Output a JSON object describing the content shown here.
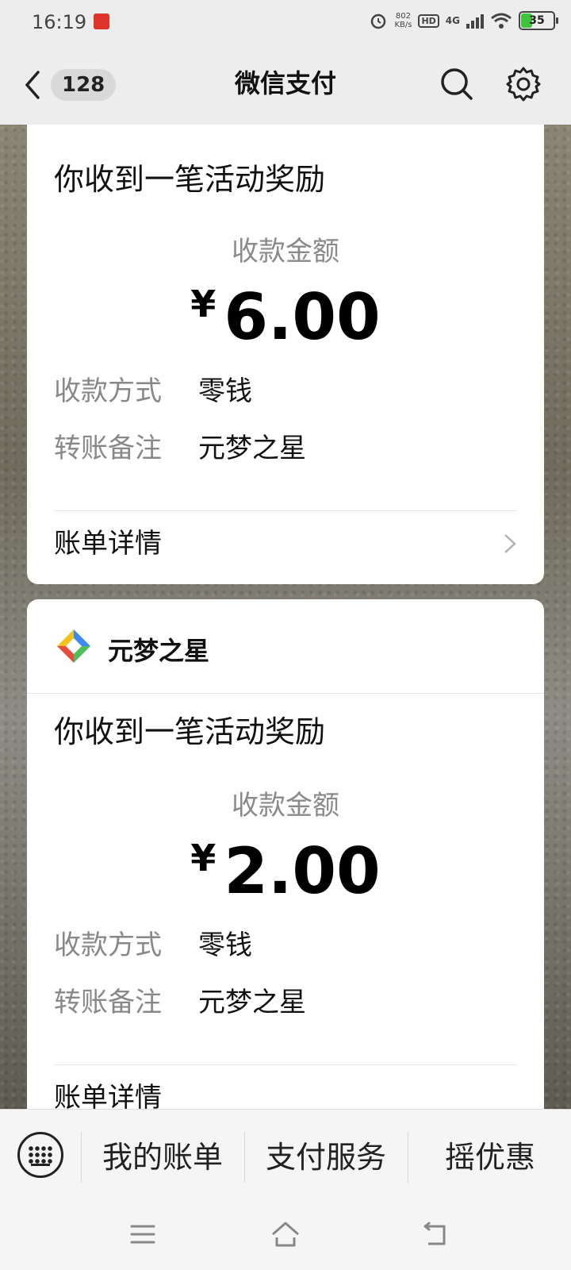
{
  "status_bar": {
    "time": "16:19",
    "net_speed_value": "802",
    "net_speed_unit": "KB/s",
    "hd": "HD",
    "signal": "4G",
    "battery": "35"
  },
  "header": {
    "back_count": "128",
    "title": "微信支付"
  },
  "cards": [
    {
      "title": "你收到一笔活动奖励",
      "amount_label": "收款金额",
      "currency": "¥",
      "amount": "6.00",
      "method_label": "收款方式",
      "method_value": "零钱",
      "note_label": "转账备注",
      "note_value": "元梦之星",
      "detail_label": "账单详情"
    },
    {
      "brand_name": "元梦之星",
      "title": "你收到一笔活动奖励",
      "amount_label": "收款金额",
      "currency": "¥",
      "amount": "2.00",
      "method_label": "收款方式",
      "method_value": "零钱",
      "note_label": "转账备注",
      "note_value": "元梦之星",
      "detail_label": "账单详情"
    }
  ],
  "bottom_tabs": [
    "我的账单",
    "支付服务",
    "摇优惠"
  ],
  "colors": {
    "header_bg": "#ededed",
    "card_bg": "#ffffff",
    "muted_text": "#888888",
    "battery_green": "#3ec43e"
  }
}
